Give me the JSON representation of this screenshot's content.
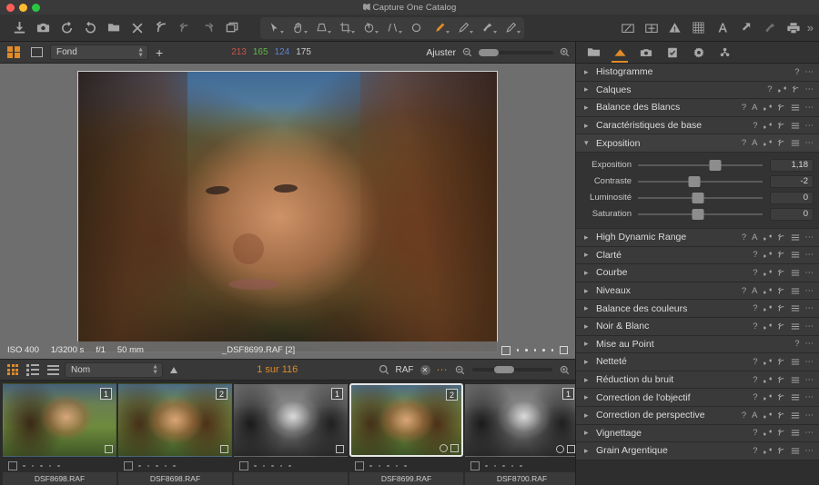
{
  "window": {
    "title": "Capture One Catalog",
    "traffic_lights": [
      "close",
      "minimize",
      "zoom"
    ]
  },
  "toolbar": {
    "left_tools": [
      {
        "name": "import-images",
        "icon": "download-icon"
      },
      {
        "name": "capture-tethered",
        "icon": "camera-icon"
      },
      {
        "name": "rotate-left",
        "icon": "rotate-ccw-icon"
      },
      {
        "name": "rotate-right",
        "icon": "rotate-cw-icon"
      },
      {
        "name": "move-to-folder",
        "icon": "folder-move-icon"
      },
      {
        "name": "delete",
        "icon": "close-x-icon"
      },
      {
        "name": "reset-adjustments",
        "icon": "undo-arrow-icon"
      },
      {
        "name": "undo",
        "icon": "arrow-back-icon"
      },
      {
        "name": "redo",
        "icon": "arrow-forward-icon"
      },
      {
        "name": "copy-apply-adjustments",
        "icon": "copy-layers-icon"
      }
    ],
    "cursor_tools": [
      {
        "name": "select-tool",
        "icon": "arrow-pointer-icon",
        "active": false
      },
      {
        "name": "pan-tool",
        "icon": "hand-icon",
        "active": false
      },
      {
        "name": "keystone-tool",
        "icon": "keystone-icon",
        "active": false
      },
      {
        "name": "crop-tool",
        "icon": "crop-icon",
        "active": false
      },
      {
        "name": "rotate-tool",
        "icon": "rotation-icon",
        "active": false
      },
      {
        "name": "straighten-tool",
        "icon": "straighten-icon",
        "active": false
      },
      {
        "name": "spot-removal-tool",
        "icon": "spot-circle-icon",
        "active": false
      },
      {
        "name": "draw-mask-tool",
        "icon": "brush-orange-icon",
        "active": true
      },
      {
        "name": "erase-mask-tool",
        "icon": "eraser-pen-icon",
        "active": false
      },
      {
        "name": "gradient-mask-tool",
        "icon": "gradient-brush-icon",
        "active": false
      },
      {
        "name": "heal-clone-tool",
        "icon": "clone-pen-icon",
        "active": false
      }
    ],
    "right_tools": [
      {
        "name": "proof-view",
        "icon": "proof-preview-icon"
      },
      {
        "name": "compare-variants",
        "icon": "compare-split-icon"
      },
      {
        "name": "exposure-warning",
        "icon": "warning-triangle-icon"
      },
      {
        "name": "grid-overlay",
        "icon": "grid-overlay-icon"
      },
      {
        "name": "annotations-text",
        "icon": "text-annotation-icon"
      },
      {
        "name": "export-images",
        "icon": "export-arrow-icon"
      },
      {
        "name": "open-with",
        "icon": "open-with-icon"
      },
      {
        "name": "print",
        "icon": "printer-icon"
      }
    ],
    "overflow_label": "»"
  },
  "viewer_bar": {
    "grid_view_icon": "grid-view-icon",
    "single_view_icon": "single-view-icon",
    "collection_value": "Fond",
    "add_icon": "add-plus-icon",
    "readout": {
      "r": "213",
      "g": "165",
      "b": "124",
      "k": "175"
    },
    "fit_label": "Ajuster",
    "zoom_out_icon": "zoom-out-icon",
    "zoom_in_icon": "zoom-in-icon"
  },
  "viewer": {
    "exif": [
      "ISO 400",
      "1/3200 s",
      "f/1",
      "50 mm"
    ],
    "filename": "_DSF8699.RAF [2]",
    "rating_dots": 5,
    "checkbox_icon": "selection-checkbox-icon",
    "meta_icon": "metadata-icon"
  },
  "browser_bar": {
    "view_grid_icon": "browser-grid-icon",
    "view_list_icon": "browser-list-icon",
    "view_rows_icon": "browser-rows-icon",
    "sort_value": "Nom",
    "sort_direction_icon": "sort-ascending-icon",
    "counter": "1 sur 116",
    "search_icon": "search-filter-icon",
    "filter_value": "RAF",
    "clear_filter_icon": "clear-filter-icon",
    "more_icon": "more-options-icon",
    "zoom_out_icon": "zoom-out-icon",
    "zoom_in_icon": "zoom-in-icon"
  },
  "filmstrip": {
    "thumbnails": [
      {
        "name": "DSF8698.RAF",
        "badge": "1",
        "style": "t-color-a",
        "selected": false
      },
      {
        "name": "DSF8698.RAF",
        "badge": "2",
        "style": "t-color-b",
        "selected": false
      },
      {
        "name": "",
        "badge": "1",
        "style": "t-bw",
        "selected": false
      },
      {
        "name": "DSF8699.RAF",
        "badge": "2",
        "style": "t-color-b",
        "selected": true
      },
      {
        "name": "DSF8700.RAF",
        "badge": "1",
        "style": "t-bw",
        "selected": false
      }
    ]
  },
  "right_panel": {
    "tabs": [
      {
        "name": "library-tab",
        "icon": "folder-icon",
        "active": false
      },
      {
        "name": "color-tab",
        "icon": "color-adjust-icon",
        "active": true
      },
      {
        "name": "capture-tab",
        "icon": "camera-icon",
        "active": false
      },
      {
        "name": "metadata-tab",
        "icon": "checklist-icon",
        "active": false
      },
      {
        "name": "adjustments-tab",
        "icon": "gear-icon",
        "active": false
      },
      {
        "name": "exports-tab",
        "icon": "share-nodes-icon",
        "active": false
      }
    ],
    "tools": [
      {
        "label": "Histogramme",
        "expanded": false,
        "actions": [
          "help",
          "more"
        ]
      },
      {
        "label": "Calques",
        "expanded": false,
        "actions": [
          "help",
          "copy",
          "reset",
          "more"
        ]
      },
      {
        "label": "Balance des Blancs",
        "expanded": false,
        "actions": [
          "help",
          "auto",
          "copy",
          "reset",
          "menu",
          "more"
        ]
      },
      {
        "label": "Caractéristiques de base",
        "expanded": false,
        "actions": [
          "help",
          "copy",
          "reset",
          "menu",
          "more"
        ]
      },
      {
        "label": "Exposition",
        "expanded": true,
        "actions": [
          "help",
          "auto",
          "copy",
          "reset",
          "menu",
          "more"
        ]
      },
      {
        "label": "High Dynamic Range",
        "expanded": false,
        "actions": [
          "help",
          "auto",
          "copy",
          "reset",
          "menu",
          "more"
        ]
      },
      {
        "label": "Clarté",
        "expanded": false,
        "actions": [
          "help",
          "copy",
          "reset",
          "menu",
          "more"
        ]
      },
      {
        "label": "Courbe",
        "expanded": false,
        "actions": [
          "help",
          "copy",
          "reset",
          "menu",
          "more"
        ]
      },
      {
        "label": "Niveaux",
        "expanded": false,
        "actions": [
          "help",
          "auto",
          "copy",
          "reset",
          "menu",
          "more"
        ]
      },
      {
        "label": "Balance des couleurs",
        "expanded": false,
        "actions": [
          "help",
          "copy",
          "reset",
          "menu",
          "more"
        ]
      },
      {
        "label": "Noir & Blanc",
        "expanded": false,
        "actions": [
          "help",
          "copy",
          "reset",
          "menu",
          "more"
        ]
      },
      {
        "label": "Mise au Point",
        "expanded": false,
        "actions": [
          "help",
          "more"
        ]
      },
      {
        "label": "Netteté",
        "expanded": false,
        "actions": [
          "help",
          "copy",
          "reset",
          "menu",
          "more"
        ]
      },
      {
        "label": "Réduction du bruit",
        "expanded": false,
        "actions": [
          "help",
          "copy",
          "reset",
          "menu",
          "more"
        ]
      },
      {
        "label": "Correction de l'objectif",
        "expanded": false,
        "actions": [
          "help",
          "copy",
          "reset",
          "menu",
          "more"
        ]
      },
      {
        "label": "Correction de perspective",
        "expanded": false,
        "actions": [
          "help",
          "auto",
          "copy",
          "reset",
          "menu",
          "more"
        ]
      },
      {
        "label": "Vignettage",
        "expanded": false,
        "actions": [
          "help",
          "copy",
          "reset",
          "menu",
          "more"
        ]
      },
      {
        "label": "Grain Argentique",
        "expanded": false,
        "actions": [
          "help",
          "copy",
          "reset",
          "menu",
          "more"
        ]
      }
    ],
    "exposure_panel": {
      "sliders": [
        {
          "label": "Exposition",
          "value": "1,18",
          "pos": 62
        },
        {
          "label": "Contraste",
          "value": "-2",
          "pos": 45
        },
        {
          "label": "Luminosité",
          "value": "0",
          "pos": 48
        },
        {
          "label": "Saturation",
          "value": "0",
          "pos": 48
        }
      ]
    }
  },
  "colors": {
    "accent": "#e08a28",
    "panel_bg": "#2e2e2e",
    "row_bg": "#3a3a3a",
    "toolbar_bg": "#333333",
    "viewer_bg": "#6e6e6e",
    "text": "#dcdcdc"
  }
}
